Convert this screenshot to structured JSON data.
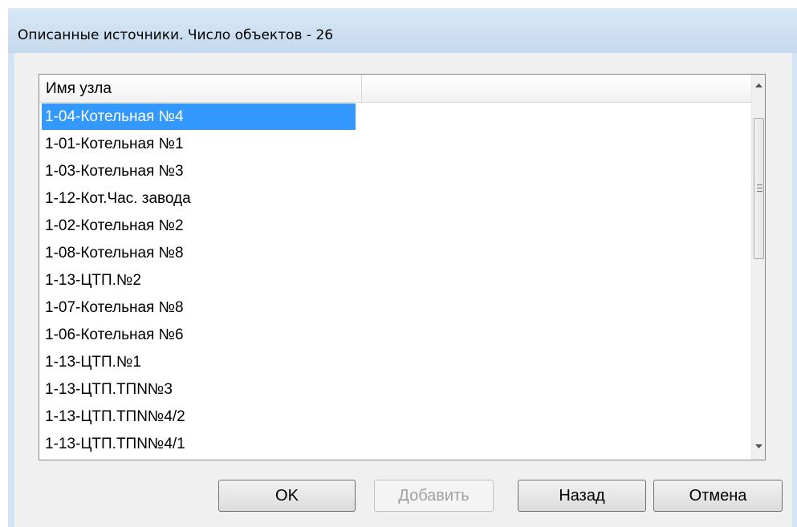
{
  "dialog": {
    "title": "Описанные источники. Число объектов - 26"
  },
  "list": {
    "columns": [
      "Имя узла",
      ""
    ],
    "rows": [
      "1-04-Котельная №4",
      "1-01-Котельная №1",
      "1-03-Котельная №3",
      "1-12-Кот.Час. завода",
      "1-02-Котельная №2",
      "1-08-Котельная №8",
      "1-13-ЦТП.№2",
      "1-07-Котельная №8",
      "1-06-Котельная №6",
      "1-13-ЦТП.№1",
      "1-13-ЦТП.ТПN№3",
      "1-13-ЦТП.ТПN№4/2",
      "1-13-ЦТП.ТПN№4/1"
    ],
    "selected_index": 0
  },
  "buttons": {
    "ok": "OK",
    "add": "Добавить",
    "back": "Назад",
    "cancel": "Отмена"
  },
  "icons": {
    "scroll_up": "triangle-up-icon",
    "scroll_down": "triangle-down-icon",
    "thumb_grip": "grip-icon"
  }
}
